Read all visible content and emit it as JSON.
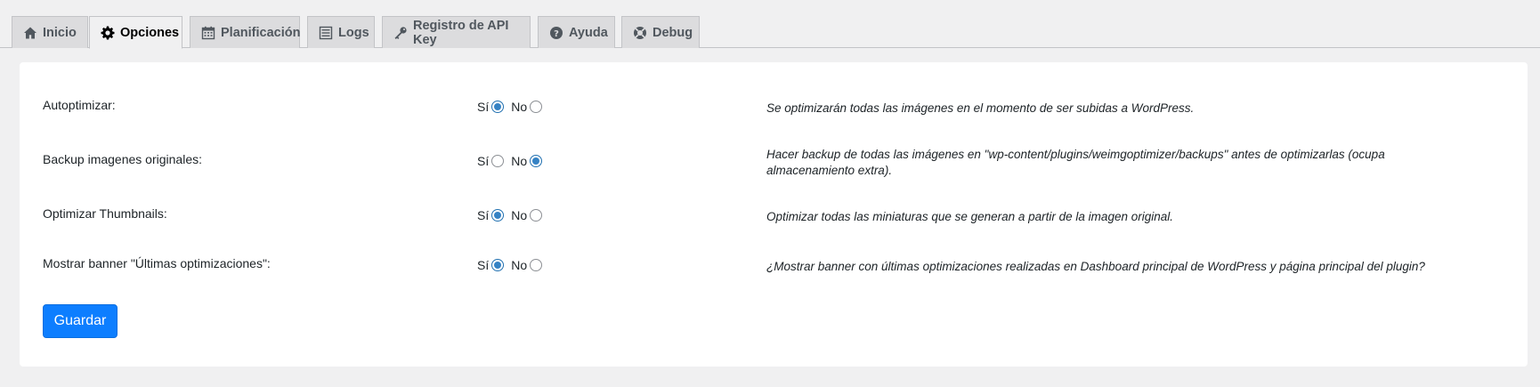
{
  "tabs": [
    {
      "label": "Inicio",
      "icon": "home-icon",
      "active": false
    },
    {
      "label": "Opciones",
      "icon": "gear-icon",
      "active": true
    },
    {
      "label": "Planificación",
      "icon": "calendar-icon",
      "active": false
    },
    {
      "label": "Logs",
      "icon": "list-icon",
      "active": false
    },
    {
      "label": "Registro de API Key",
      "icon": "key-icon",
      "active": false
    },
    {
      "label": "Ayuda",
      "icon": "help-icon",
      "active": false
    },
    {
      "label": "Debug",
      "icon": "lifebuoy-icon",
      "active": false
    }
  ],
  "options": [
    {
      "label": "Autoptimizar:",
      "yes": "Sí",
      "no": "No",
      "selected": "yes",
      "description": "Se optimizarán todas las imágenes en el momento de ser subidas a WordPress."
    },
    {
      "label": "Backup imagenes originales:",
      "yes": "Sí",
      "no": "No",
      "selected": "no",
      "description": "Hacer backup de todas las imágenes en \"wp-content/plugins/weimgoptimizer/backups\" antes de optimizarlas (ocupa almacenamiento extra)."
    },
    {
      "label": "Optimizar Thumbnails:",
      "yes": "Sí",
      "no": "No",
      "selected": "yes",
      "description": "Optimizar todas las miniaturas que se generan a partir de la imagen original."
    },
    {
      "label": "Mostrar banner \"Últimas optimizaciones\":",
      "yes": "Sí",
      "no": "No",
      "selected": "yes",
      "description": "¿Mostrar banner con últimas optimizaciones realizadas en Dashboard principal de WordPress y página principal del plugin?"
    }
  ],
  "save_label": "Guardar",
  "colors": {
    "accent": "#0d7eff",
    "radio_checked": "#3582c4"
  }
}
